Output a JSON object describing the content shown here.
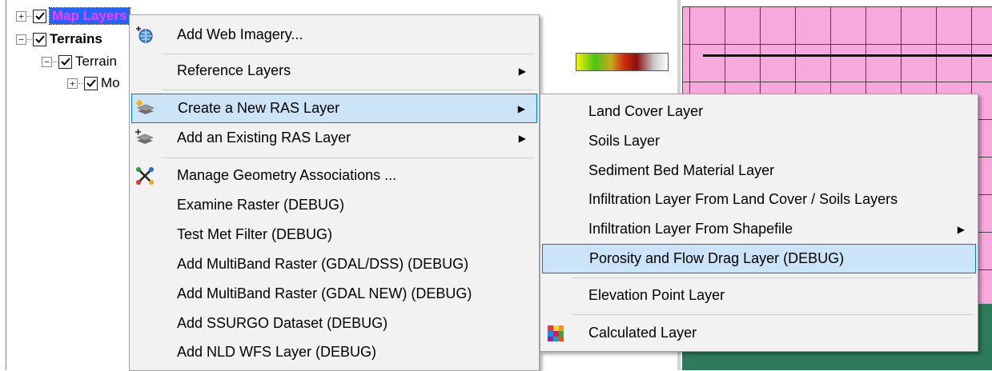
{
  "tree": {
    "nodes": [
      {
        "expander": "+",
        "label": "Map Layers"
      },
      {
        "expander": "−",
        "label": "Terrains"
      },
      {
        "expander": "−",
        "label": "Terrain"
      },
      {
        "expander": "+",
        "label": "Mo"
      }
    ]
  },
  "context_menu": {
    "items": [
      {
        "label": "Add Web Imagery...",
        "icon": "globe-add-icon"
      },
      {
        "label": "Reference Layers",
        "icon": "",
        "submenu": true
      },
      {
        "label": "Create a New RAS Layer",
        "icon": "layers-new-icon",
        "submenu": true
      },
      {
        "label": "Add an Existing RAS Layer",
        "icon": "layers-add-icon",
        "submenu": true
      },
      {
        "label": "Manage Geometry Associations ...",
        "icon": "geometry-associations-icon"
      },
      {
        "label": "Examine Raster (DEBUG)"
      },
      {
        "label": "Test Met Filter (DEBUG)"
      },
      {
        "label": "Add MultiBand Raster (GDAL/DSS) (DEBUG)"
      },
      {
        "label": "Add MultiBand Raster (GDAL NEW) (DEBUG)"
      },
      {
        "label": "Add SSURGO Dataset (DEBUG)"
      },
      {
        "label": "Add NLD WFS Layer (DEBUG)"
      }
    ]
  },
  "submenu": {
    "items": [
      {
        "label": "Land Cover Layer"
      },
      {
        "label": "Soils Layer"
      },
      {
        "label": "Sediment Bed Material Layer"
      },
      {
        "label": "Infiltration Layer From Land Cover / Soils Layers"
      },
      {
        "label": "Infiltration Layer From Shapefile",
        "submenu": true
      },
      {
        "label": "Porosity and Flow Drag Layer (DEBUG)"
      },
      {
        "label": "Elevation Point Layer"
      },
      {
        "label": "Calculated Layer",
        "icon": "calculated-layer-icon"
      }
    ]
  },
  "colors": {
    "menu_highlight": "#cce4f7",
    "menu_highlight_border": "#0078d7",
    "map_fill": "#f7a8dc",
    "map_lower": "#2d7a5c",
    "selected_layer_bg": "#1f66ff"
  }
}
